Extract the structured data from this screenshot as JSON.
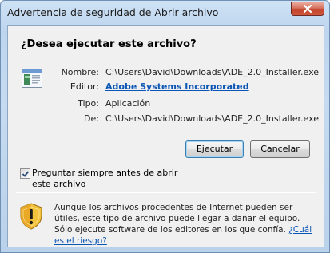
{
  "window": {
    "title": "Advertencia de seguridad de Abrir archivo"
  },
  "dialog": {
    "question": "¿Desea ejecutar este archivo?",
    "fields": {
      "name_label": "Nombre:",
      "name_value": "C:\\Users\\David\\Downloads\\ADE_2.0_Installer.exe",
      "publisher_label": "Editor:",
      "publisher_value": "Adobe Systems Incorporated",
      "type_label": "Tipo:",
      "type_value": "Aplicación",
      "from_label": "De:",
      "from_value": "C:\\Users\\David\\Downloads\\ADE_2.0_Installer.exe"
    },
    "buttons": {
      "run_label": "Ejecutar",
      "cancel_label": "Cancelar"
    },
    "checkbox": {
      "label": "Preguntar siempre antes de abrir este archivo",
      "checked": true
    },
    "warning": {
      "text": "Aunque los archivos procedentes de Internet pueden ser útiles, este tipo de archivo puede llegar a dañar el equipo. Sólo ejecute software de los editores en los que confía.",
      "link_text": "¿Cuál es el riesgo?"
    }
  },
  "icons": {
    "close": "close-icon",
    "file": "executable-file-icon",
    "checkmark": "checkmark-icon",
    "shield": "security-shield-warning-icon"
  },
  "colors": {
    "frame": "#bdd5ee",
    "client": "#f0f0f0",
    "link": "#0b55b5",
    "close_button": "#c2432c"
  }
}
